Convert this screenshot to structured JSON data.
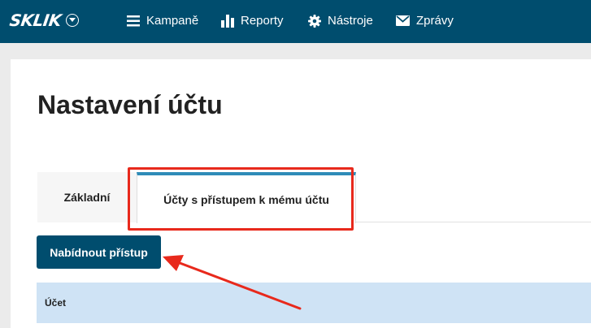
{
  "app": {
    "logo": "SKLIK"
  },
  "nav": {
    "items": [
      {
        "label": "Kampaně",
        "icon": "menu-icon"
      },
      {
        "label": "Reporty",
        "icon": "bar-chart-icon"
      },
      {
        "label": "Nástroje",
        "icon": "gear-icon"
      },
      {
        "label": "Zprávy",
        "icon": "envelope-icon"
      }
    ]
  },
  "page": {
    "title": "Nastavení účtu"
  },
  "tabs": [
    {
      "label": "Základní",
      "active": false
    },
    {
      "label": "Účty s přístupem k mému účtu",
      "active": true
    }
  ],
  "actions": {
    "offer_access_label": "Nabídnout přístup"
  },
  "table": {
    "columns": [
      "Účet"
    ]
  },
  "colors": {
    "brand": "#004d6e",
    "active_tab_accent": "#2e8cb8",
    "table_header_bg": "#cfe3f5",
    "annotation": "#e8291c"
  }
}
